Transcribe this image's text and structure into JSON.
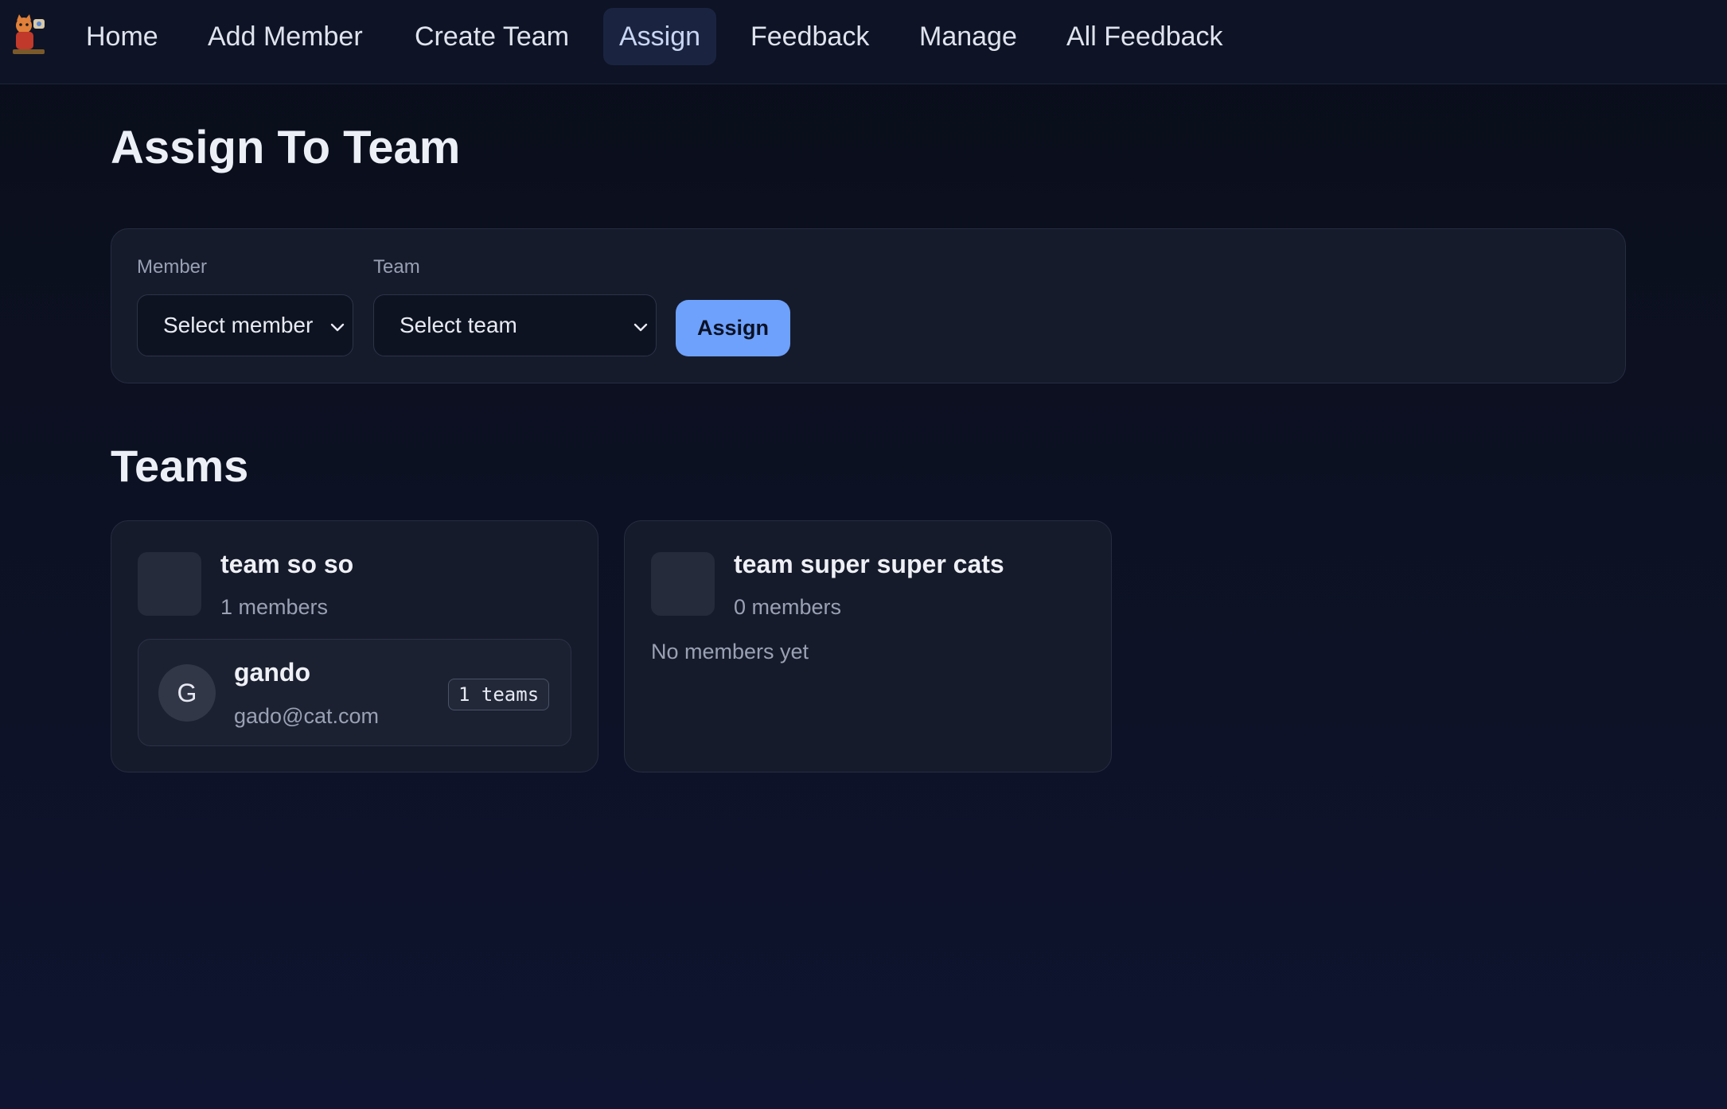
{
  "nav": {
    "logo_icon": "cat-mascot-icon",
    "items": [
      {
        "label": "Home"
      },
      {
        "label": "Add Member"
      },
      {
        "label": "Create Team"
      },
      {
        "label": "Assign",
        "active": true
      },
      {
        "label": "Feedback"
      },
      {
        "label": "Manage"
      },
      {
        "label": "All Feedback"
      }
    ]
  },
  "page": {
    "title": "Assign To Team"
  },
  "assign_form": {
    "member_label": "Member",
    "member_value": "Select member",
    "team_label": "Team",
    "team_value": "Select team",
    "submit_label": "Assign"
  },
  "teams_section": {
    "title": "Teams",
    "teams": [
      {
        "name": "team so so",
        "count_text": "1 members",
        "members": [
          {
            "initial": "G",
            "name": "gando",
            "email": "gado@cat.com",
            "badge": "1 teams"
          }
        ]
      },
      {
        "name": "team super super cats",
        "count_text": "0 members",
        "empty_text": "No members yet"
      }
    ]
  },
  "colors": {
    "accent": "#6ea1fb",
    "background": "#0a0e1a",
    "card": "#161b2b",
    "active_nav": "#1a2440"
  }
}
